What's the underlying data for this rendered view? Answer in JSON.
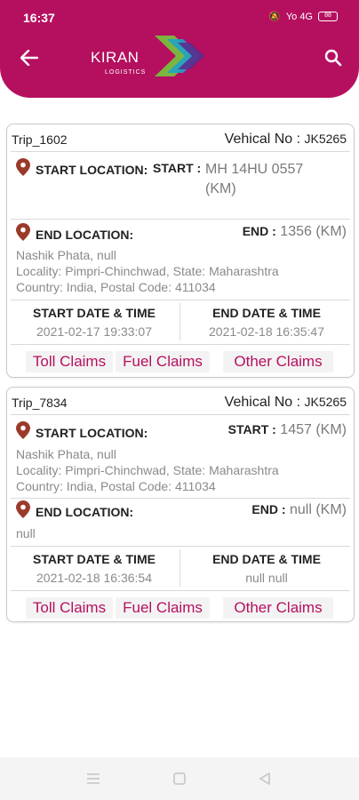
{
  "status_bar": {
    "time": "16:37",
    "signal": "Yo 4G",
    "battery": "88"
  },
  "header": {
    "logo_name": "KIRAN",
    "logo_sub": "LOGISTICS",
    "back_icon": "arrow-left-icon",
    "search_icon": "search-icon",
    "brand_color": "#b5105f"
  },
  "trips": [
    {
      "trip_id": "Trip_1602",
      "vehicle_label": "Vehical No :",
      "vehicle_no": "JK5265",
      "start_location_label": "START LOCATION:",
      "start_key": "START :",
      "start_value_line1": "MH 14HU 0557",
      "start_value_line2": "(KM)",
      "end_location_label": "END LOCATION:",
      "end_key": "END :",
      "end_value": "1356 (KM)",
      "end_address": [
        "Nashik Phata, null",
        "Locality: Pimpri-Chinchwad, State: Maharashtra",
        "Country: India, Postal Code: 411034"
      ],
      "start_dt_title": "START DATE & TIME",
      "start_dt": "2021-02-17 19:33:07",
      "end_dt_title": "END DATE & TIME",
      "end_dt": "2021-02-18 16:35:47",
      "claims": [
        "Toll Claims",
        "Fuel Claims",
        "Other Claims"
      ]
    },
    {
      "trip_id": "Trip_7834",
      "vehicle_label": "Vehical No :",
      "vehicle_no": "JK5265",
      "start_location_label": "START LOCATION:",
      "start_key": "START :",
      "start_value": "1457 (KM)",
      "start_address": [
        "Nashik Phata, null",
        "Locality: Pimpri-Chinchwad, State: Maharashtra",
        "Country: India, Postal Code: 411034"
      ],
      "end_location_label": "END LOCATION:",
      "end_key": "END :",
      "end_value": "null (KM)",
      "end_address": [
        "null"
      ],
      "start_dt_title": "START DATE & TIME",
      "start_dt": "2021-02-18 16:36:54",
      "end_dt_title": "END DATE & TIME",
      "end_dt": "null null",
      "claims": [
        "Toll Claims",
        "Fuel Claims",
        "Other Claims"
      ]
    }
  ],
  "nav_bar": {
    "items": [
      "menu-icon",
      "home-square-icon",
      "back-triangle-icon"
    ]
  }
}
